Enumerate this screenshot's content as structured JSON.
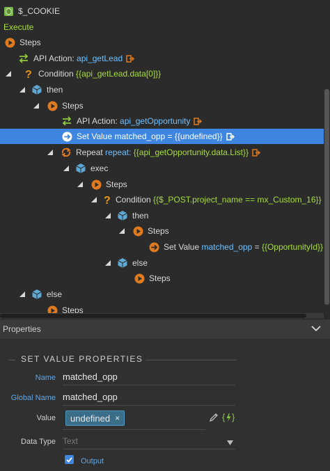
{
  "tree": {
    "root_label": "$_COOKIE",
    "execute_label": "Execute",
    "nodes": {
      "steps1": "Steps",
      "api1_prefix": "API Action:",
      "api1_name": "api_getLead",
      "cond1_prefix": "Condition",
      "cond1_expr": "{{api_getLead.data[0]}}",
      "then1": "then",
      "steps2": "Steps",
      "api2_prefix": "API Action:",
      "api2_name": "api_getOpportunity",
      "setval1_text": "Set Value matched_opp = {{undefined}}",
      "repeat_prefix": "Repeat",
      "repeat_kw": "repeat:",
      "repeat_expr": "{{api_getOpportunity.data.List}}",
      "exec": "exec",
      "steps3": "Steps",
      "cond2_prefix": "Condition",
      "cond2_expr": "{{$_POST.project_name == mx_Custom_16}}",
      "then2": "then",
      "steps4": "Steps",
      "setval2_prefix": "Set Value",
      "setval2_name": "matched_opp",
      "setval2_eq": "=",
      "setval2_expr": "{{OpportunityId}}",
      "else1": "else",
      "steps5": "Steps",
      "else2": "else",
      "steps6": "Steps"
    }
  },
  "properties": {
    "header": "Properties",
    "section_title": "SET VALUE PROPERTIES",
    "name_label": "Name",
    "name_value": "matched_opp",
    "global_name_label": "Global Name",
    "global_name_value": "matched_opp",
    "value_label": "Value",
    "value_tag": "undefined",
    "value_tag_remove": "×",
    "data_type_label": "Data Type",
    "data_type_value": "Text",
    "output_label": "Output",
    "output_checked": true
  },
  "colors": {
    "selection": "#3f86e1",
    "keyword_blue": "#6fc0ff",
    "expression_green": "#a6dd3b",
    "label_blue": "#5aa9ec"
  }
}
